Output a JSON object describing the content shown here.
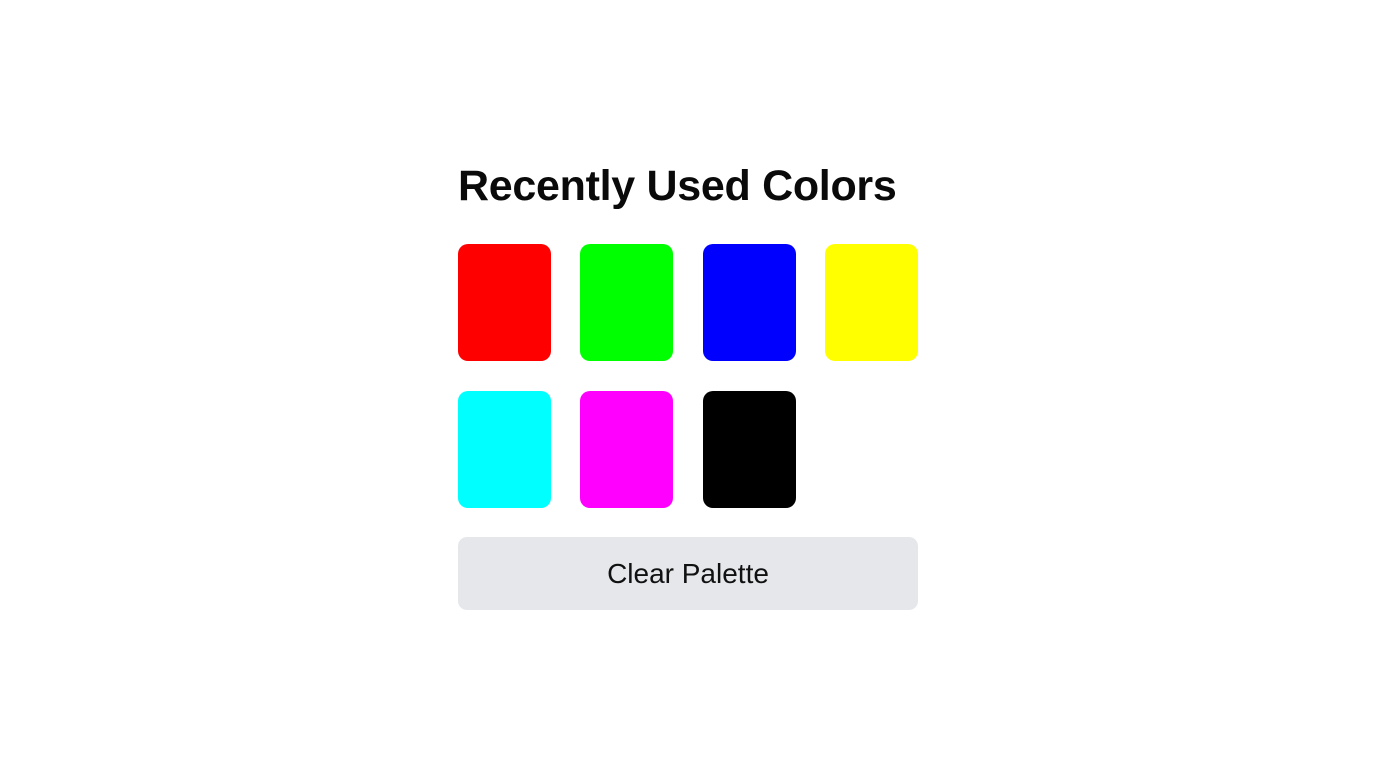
{
  "title": "Recently Used Colors",
  "swatches": [
    {
      "name": "red",
      "color": "#ff0000"
    },
    {
      "name": "green",
      "color": "#00ff00"
    },
    {
      "name": "blue",
      "color": "#0000ff"
    },
    {
      "name": "yellow",
      "color": "#ffff00"
    },
    {
      "name": "cyan",
      "color": "#00ffff"
    },
    {
      "name": "magenta",
      "color": "#ff00ff"
    },
    {
      "name": "black",
      "color": "#000000"
    }
  ],
  "clear_button": {
    "label": "Clear Palette"
  }
}
